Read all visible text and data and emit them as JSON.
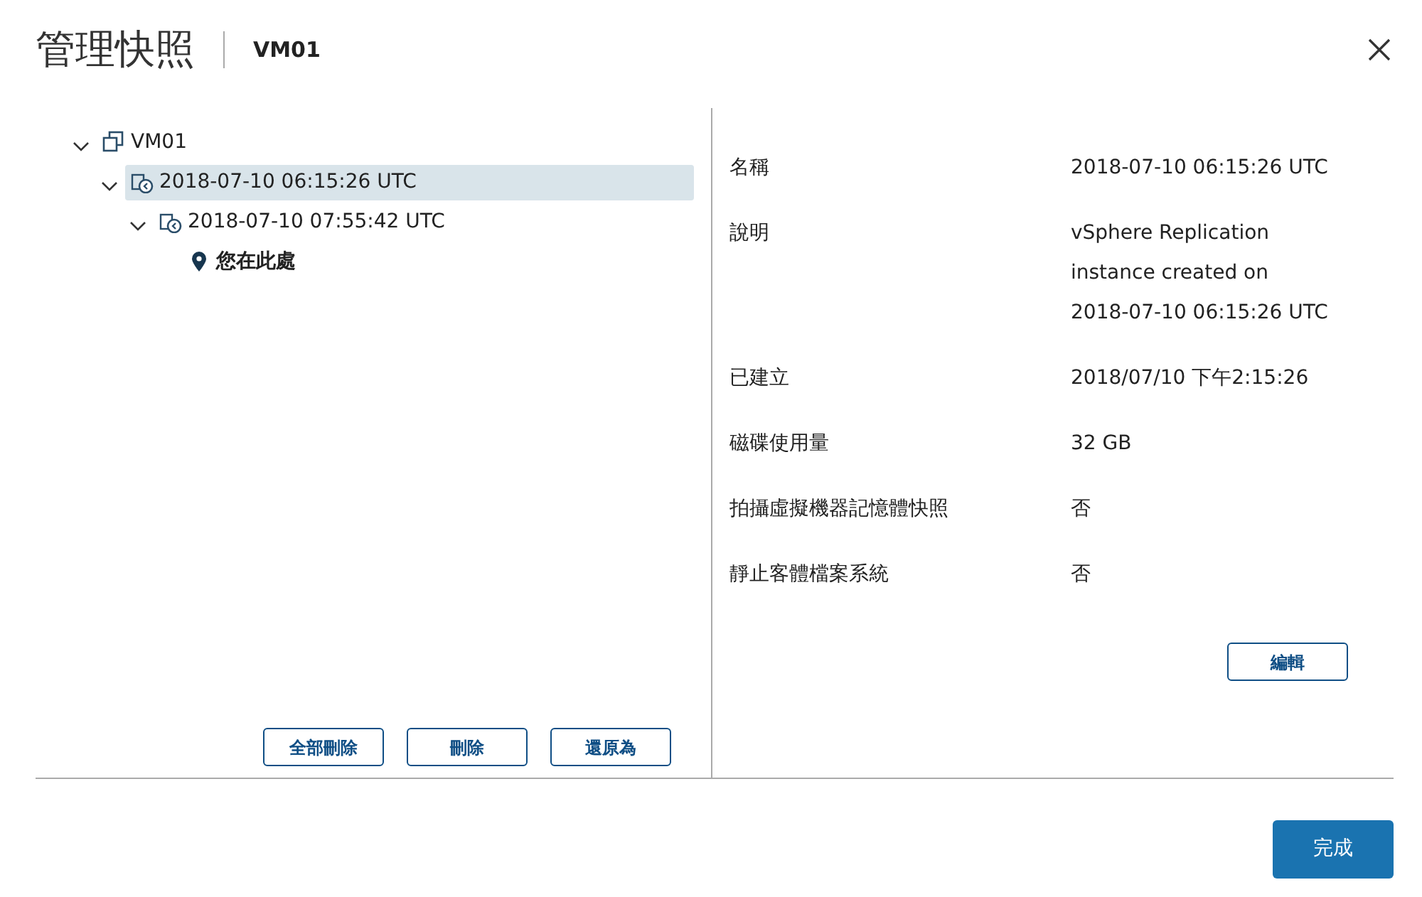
{
  "dialog": {
    "title": "管理快照",
    "subtitle": "VM01"
  },
  "tree": [
    {
      "kind": "vm",
      "label": "VM01",
      "expanded": true,
      "selected": false,
      "children": [
        {
          "kind": "snapshot",
          "label": "2018-07-10 06:15:26 UTC",
          "expanded": true,
          "selected": true,
          "children": [
            {
              "kind": "snapshot",
              "label": "2018-07-10 07:55:42 UTC",
              "expanded": true,
              "selected": false,
              "children": [
                {
                  "kind": "location",
                  "label": "您在此處",
                  "selected": false
                }
              ]
            }
          ]
        }
      ]
    }
  ],
  "tree_buttons": [
    "全部刪除",
    "刪除",
    "還原為"
  ],
  "details": [
    {
      "label": "名稱",
      "lines": [
        "2018-07-10 06:15:26 UTC"
      ]
    },
    {
      "label": "說明",
      "lines": [
        "vSphere Replication",
        "instance created on",
        "2018-07-10 06:15:26 UTC"
      ]
    },
    {
      "label": "已建立",
      "lines": [
        "2018/07/10 下午2:15:26"
      ]
    },
    {
      "label": "磁碟使用量",
      "lines": [
        "32 GB"
      ]
    },
    {
      "label": "拍攝虛擬機器記憶體快照",
      "lines": [
        "否"
      ]
    },
    {
      "label": "靜止客體檔案系統",
      "lines": [
        "否"
      ]
    }
  ],
  "edit_button": "編輯",
  "done_button": "完成"
}
